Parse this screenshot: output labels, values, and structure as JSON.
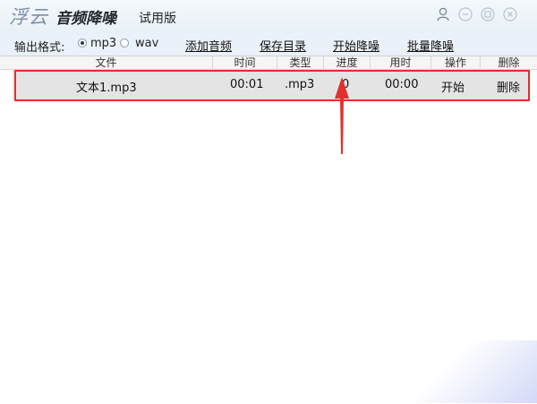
{
  "app": {
    "logo_script": "浮云",
    "logo_name": "音频降噪",
    "edition": "试用版"
  },
  "toolbar": {
    "format_label": "输出格式:",
    "formats": [
      {
        "label": "mp3",
        "checked": true
      },
      {
        "label": "wav",
        "checked": false
      }
    ],
    "add_audio": "添加音频",
    "save_dir": "保存目录",
    "start_denoise": "开始降噪",
    "batch_denoise": "批量降噪"
  },
  "table": {
    "columns": [
      "文件",
      "时间",
      "类型",
      "进度",
      "用时",
      "操作",
      "删除"
    ],
    "rows": [
      {
        "file": "文本1.mp3",
        "time": "00:01",
        "type": ".mp3",
        "progress": "0",
        "elapsed": "00:00",
        "action": "开始",
        "delete": "删除"
      }
    ]
  },
  "colors": {
    "highlight": "#e0302e",
    "window_bg": "#eaf1f8"
  },
  "icons": [
    "user-icon",
    "minimize-icon",
    "restore-icon",
    "close-icon"
  ]
}
